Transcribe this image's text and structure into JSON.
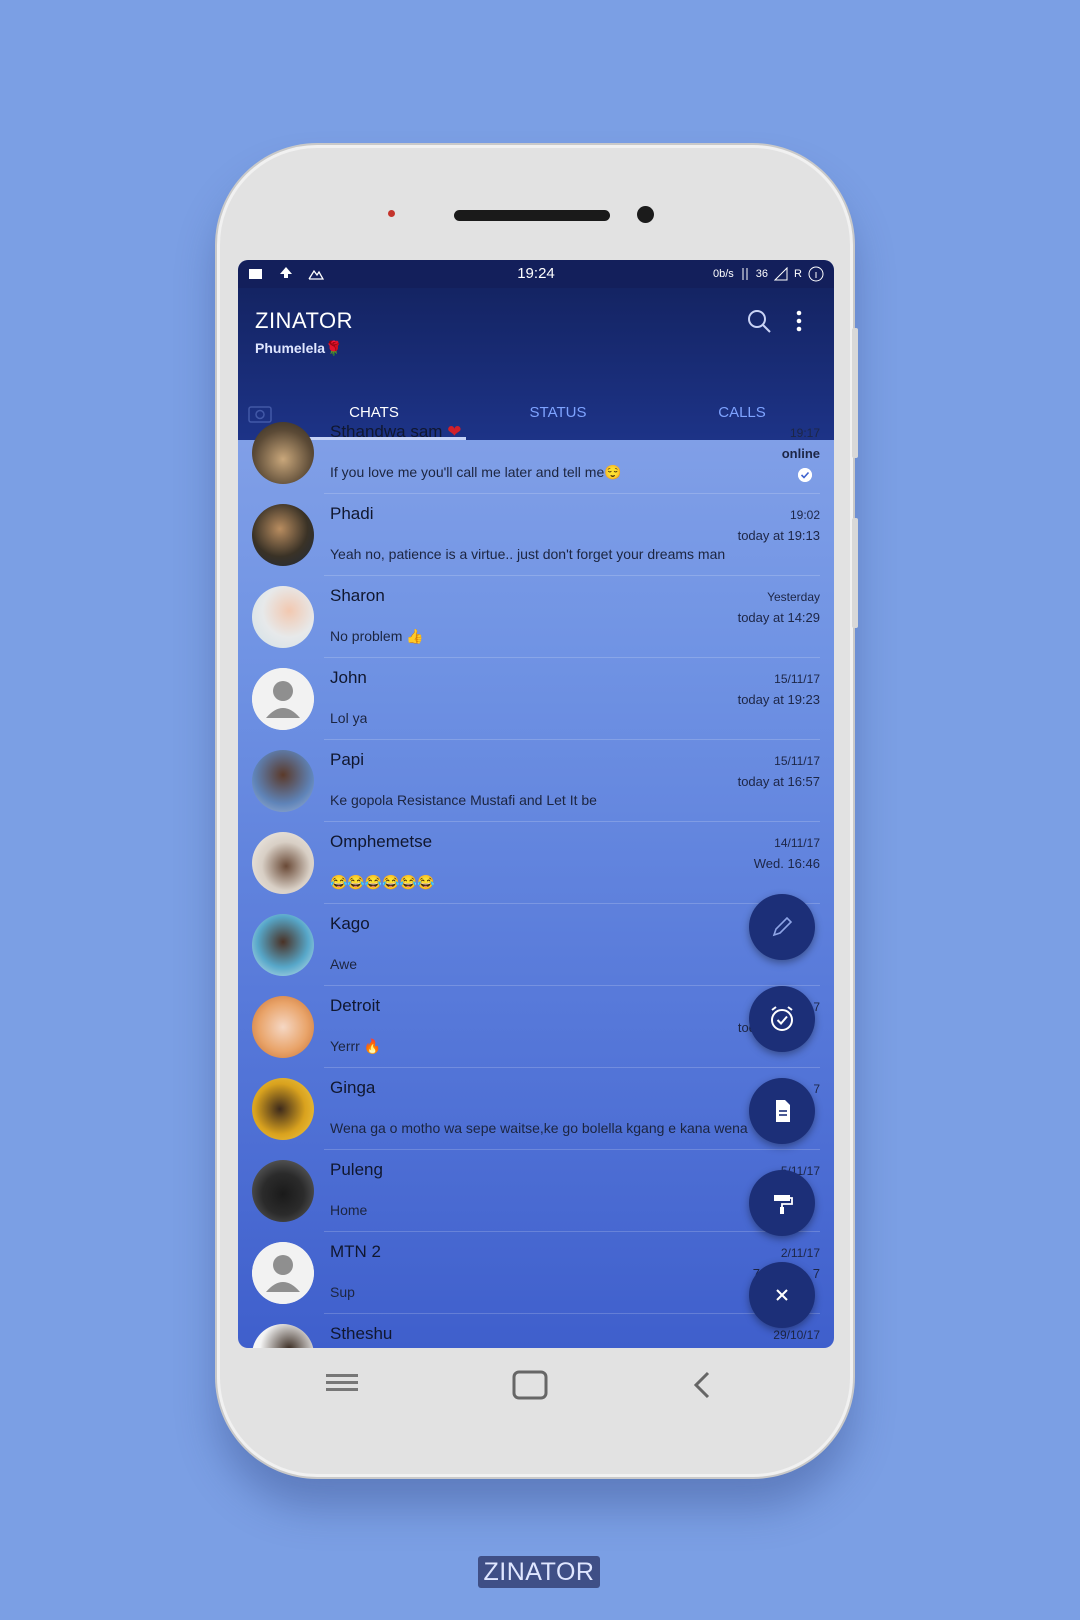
{
  "status_bar": {
    "time": "19:24",
    "speed": "0b/s",
    "network": "36",
    "roaming": "R"
  },
  "app": {
    "title": "ZINATOR",
    "subtitle": "Phumelela🌹"
  },
  "tabs": [
    {
      "label": "CHATS",
      "active": true
    },
    {
      "label": "STATUS",
      "active": false
    },
    {
      "label": "CALLS",
      "active": false
    }
  ],
  "chats": [
    {
      "name": "Sthandwa sam",
      "name_emoji": "❤",
      "message": "If you love me you'll call me later and tell me😌",
      "time": "19:17",
      "sub": "online",
      "avatar": "photo",
      "read_tick": true
    },
    {
      "name": "Phadi",
      "message": "Yeah no, patience is a virtue.. just don't forget your dreams man",
      "time": "19:02",
      "sub": "today at 19:13",
      "avatar": "photo"
    },
    {
      "name": "Sharon",
      "message": "No problem 👍",
      "time": "Yesterday",
      "sub": "today at 14:29",
      "avatar": "photo"
    },
    {
      "name": "John",
      "message": "Lol ya",
      "time": "15/11/17",
      "sub": "today at 19:23",
      "avatar": "placeholder"
    },
    {
      "name": "Papi",
      "message": "Ke gopola Resistance Mustafi and Let It be",
      "time": "15/11/17",
      "sub": "today at 16:57",
      "avatar": "photo"
    },
    {
      "name": "Omphemetse",
      "message": "😂😂😂😂😂😂",
      "time": "14/11/17",
      "sub": "Wed. 16:46",
      "avatar": "photo"
    },
    {
      "name": "Kago",
      "message": "Awe",
      "time": "",
      "sub": "",
      "avatar": "photo"
    },
    {
      "name": "Detroit",
      "message": "Yerrr 🔥",
      "time": "7",
      "sub": "tod",
      "avatar": "photo"
    },
    {
      "name": "Ginga",
      "message": "Wena ga o motho wa sepe waitse,ke go bolella kgang e kana wena",
      "time": "7",
      "sub": "",
      "avatar": "photo"
    },
    {
      "name": "Puleng",
      "message": "Home",
      "time": "5/11/17",
      "sub": "",
      "avatar": "photo"
    },
    {
      "name": "MTN 2",
      "message": "Sup",
      "time": "2/11/17",
      "sub": "7",
      "sub_tail": "7",
      "avatar": "placeholder"
    },
    {
      "name": "Stheshu",
      "message": "",
      "time": "29/10/17",
      "sub": "",
      "avatar": "photo"
    }
  ],
  "fab_actions": [
    "pencil-icon",
    "alarm-check-icon",
    "document-icon",
    "paint-roller-icon",
    "close-icon"
  ],
  "footer_brand": "ZINATOR",
  "colors": {
    "background": "#7b9fe4",
    "appbar": "#142463",
    "fab": "#1c2f78",
    "tab_inactive": "#7ea3ff"
  }
}
